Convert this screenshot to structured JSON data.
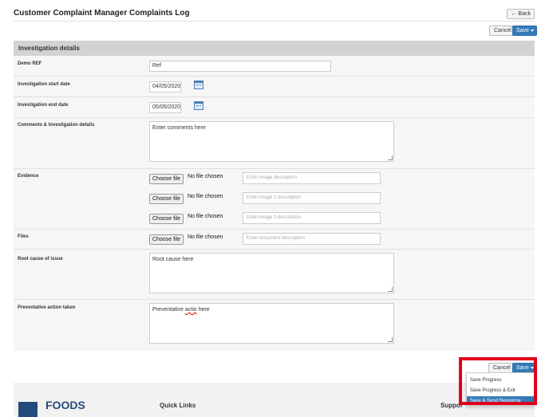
{
  "header": {
    "title": "Customer Complaint Manager Complaints Log",
    "back_label": "← Back",
    "cancel_label": "Cancel",
    "save_label": "Save"
  },
  "form": {
    "section_title": "Investigation details",
    "demo_ref": {
      "label": "Demo REF",
      "value": "Ref"
    },
    "start_date": {
      "label": "Investigation start date",
      "value": "04/05/2020"
    },
    "end_date": {
      "label": "Investigation end date",
      "value": "05/05/2020"
    },
    "comments": {
      "label": "Comments & Investigation details",
      "value": "Enter comments here"
    },
    "evidence": {
      "label": "Evidence",
      "items": [
        {
          "button": "Choose file",
          "status": "No file chosen",
          "placeholder": "Enter image description"
        },
        {
          "button": "Choose file",
          "status": "No file chosen",
          "placeholder": "Enter image 2 description"
        },
        {
          "button": "Choose file",
          "status": "No file chosen",
          "placeholder": "Enter image 3 description"
        }
      ]
    },
    "files": {
      "label": "Files",
      "button": "Choose file",
      "status": "No file chosen",
      "placeholder": "Enter document description"
    },
    "root_cause": {
      "label": "Root cause of issue",
      "value": "Root cause here"
    },
    "preventative": {
      "label": "Preventative action taken",
      "value_pre": "Preventative ",
      "value_misspelled": "actio",
      "value_post": " here"
    }
  },
  "bottom_actions": {
    "cancel_label": "Cancel",
    "save_label": "Save",
    "menu": [
      "Save Progress",
      "Save Progress & Exit",
      "Save & Send Response"
    ]
  },
  "footer": {
    "logo_text": "FOODS",
    "quick_links": "Quick Links",
    "support": "Suppor"
  },
  "colors": {
    "primary": "#337ab7",
    "highlight": "#e0001b",
    "logo": "#244b7a"
  }
}
